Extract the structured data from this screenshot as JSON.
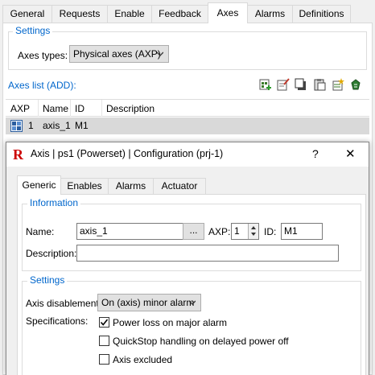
{
  "main_tabs": [
    {
      "label": "General",
      "active": false
    },
    {
      "label": "Requests",
      "active": false
    },
    {
      "label": "Enable",
      "active": false
    },
    {
      "label": "Feedback",
      "active": false
    },
    {
      "label": "Axes",
      "active": true
    },
    {
      "label": "Alarms",
      "active": false
    },
    {
      "label": "Definitions",
      "active": false
    }
  ],
  "settings": {
    "legend": "Settings",
    "axes_types_label": "Axes types:",
    "axes_types_value": "Physical axes (AXP)"
  },
  "axes_list": {
    "title": "Axes list (ADD):",
    "toolbar_icons": [
      "add-axis-icon",
      "edit-axis-icon",
      "copy-icon",
      "paste-icon",
      "new-item-icon",
      "recycle-icon"
    ],
    "columns": [
      "AXP",
      "Name",
      "ID",
      "Description"
    ],
    "rows": [
      {
        "axp": "1",
        "name": "axis_1",
        "id": "M1",
        "description": ""
      }
    ]
  },
  "dialog": {
    "logo_letter": "R",
    "title": "Axis | ps1 (Powerset) | Configuration (prj-1)",
    "help_label": "?",
    "close_label": "✕",
    "tabs": [
      {
        "label": "Generic",
        "active": true
      },
      {
        "label": "Enables",
        "active": false
      },
      {
        "label": "Alarms",
        "active": false
      },
      {
        "label": "Actuator",
        "active": false
      }
    ],
    "information": {
      "legend": "Information",
      "name_label": "Name:",
      "name_value": "axis_1",
      "browse_label": "...",
      "axp_label": "AXP:",
      "axp_value": "1",
      "id_label": "ID:",
      "id_value": "M1",
      "description_label": "Description:",
      "description_value": ""
    },
    "settings": {
      "legend": "Settings",
      "disablement_label": "Axis disablement:",
      "disablement_value": "On (axis) minor alarm",
      "specifications_label": "Specifications:",
      "options": [
        {
          "label": "Power loss on major alarm",
          "checked": true
        },
        {
          "label": "QuickStop handling on delayed power off",
          "checked": false
        },
        {
          "label": "Axis excluded",
          "checked": false
        }
      ]
    }
  },
  "colors": {
    "accent_blue": "#0066cc",
    "logo_red": "#cc0000",
    "selected_row": "#d9d9d9"
  }
}
